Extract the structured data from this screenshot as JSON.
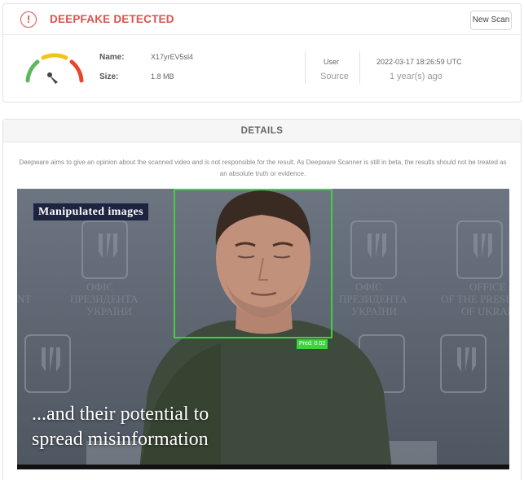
{
  "result": {
    "status_title": "DEEPFAKE DETECTED",
    "status_icon": "alert-circle-icon",
    "status_color": "#d9534f",
    "new_scan_label": "New Scan",
    "name_label": "Name:",
    "name_value": "X17yrEV5sl4",
    "size_label": "Size:",
    "size_value": "1.8 MB",
    "user_label": "User",
    "source_label": "Source",
    "date_value": "2022-03-17 18:26:59 UTC",
    "date_relative": "1 year(s) ago",
    "gauge": {
      "colors": [
        "#5cb85c",
        "#f0c419",
        "#e8452c"
      ],
      "needle_color": "#444444",
      "level": "high"
    }
  },
  "details": {
    "header": "DETAILS",
    "disclaimer": "Deepware aims to give an opinion about the scanned video and is not responsible for the result. As Deepware Scanner is still in beta, the results should not be treated as an absolute truth or evidence."
  },
  "video": {
    "caption": "Manipulated images",
    "pred_label": "Pred: 0.02",
    "box_color": "#3bd43b",
    "subtitle_line1": "...and their potential to",
    "subtitle_line2": "spread misinformation"
  }
}
